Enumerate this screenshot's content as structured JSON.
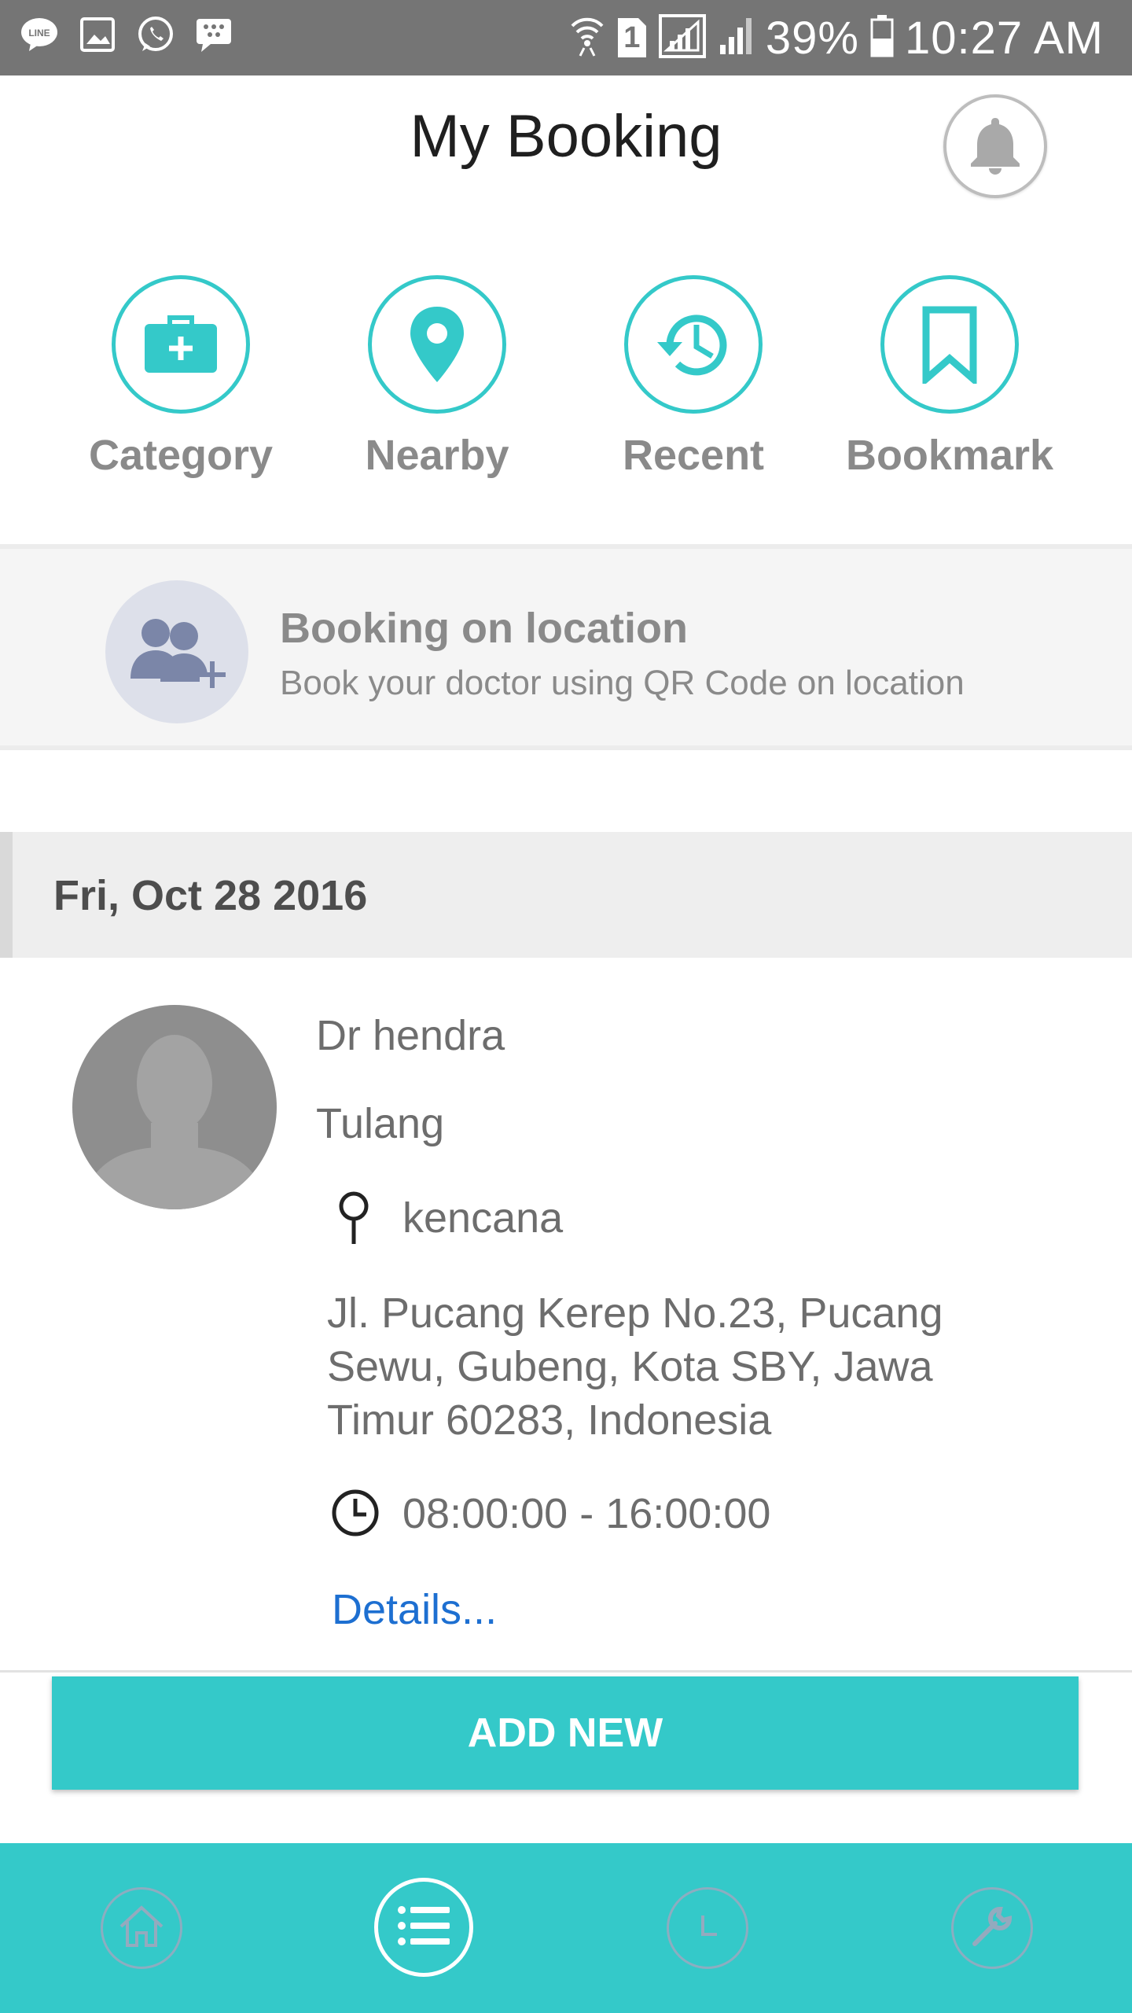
{
  "status_bar": {
    "battery": "39%",
    "time": "10:27 AM",
    "sim_slot": "1"
  },
  "header": {
    "title": "My Booking"
  },
  "quick_actions": [
    {
      "label": "Category",
      "icon": "medical-kit-icon"
    },
    {
      "label": "Nearby",
      "icon": "map-pin-icon"
    },
    {
      "label": "Recent",
      "icon": "history-clock-icon"
    },
    {
      "label": "Bookmark",
      "icon": "bookmark-icon"
    }
  ],
  "booking_on_location": {
    "title": "Booking on location",
    "subtitle": "Book your doctor using QR Code on location"
  },
  "bookings": [
    {
      "date": "Fri, Oct 28 2016",
      "doctor": "Dr hendra",
      "specialty": "Tulang",
      "location": "kencana",
      "address": "Jl. Pucang Kerep No.23, Pucang Sewu, Gubeng, Kota SBY, Jawa Timur 60283, Indonesia",
      "time": "08:00:00 - 16:00:00",
      "details_label": "Details..."
    }
  ],
  "add_new_label": "ADD NEW",
  "colors": {
    "accent": "#34c9c9",
    "link": "#1d6fd1",
    "status_bar": "#757575"
  },
  "bottom_nav": [
    "home-icon",
    "list-icon",
    "clock-icon",
    "wrench-icon"
  ],
  "bottom_nav_active": "list-icon"
}
